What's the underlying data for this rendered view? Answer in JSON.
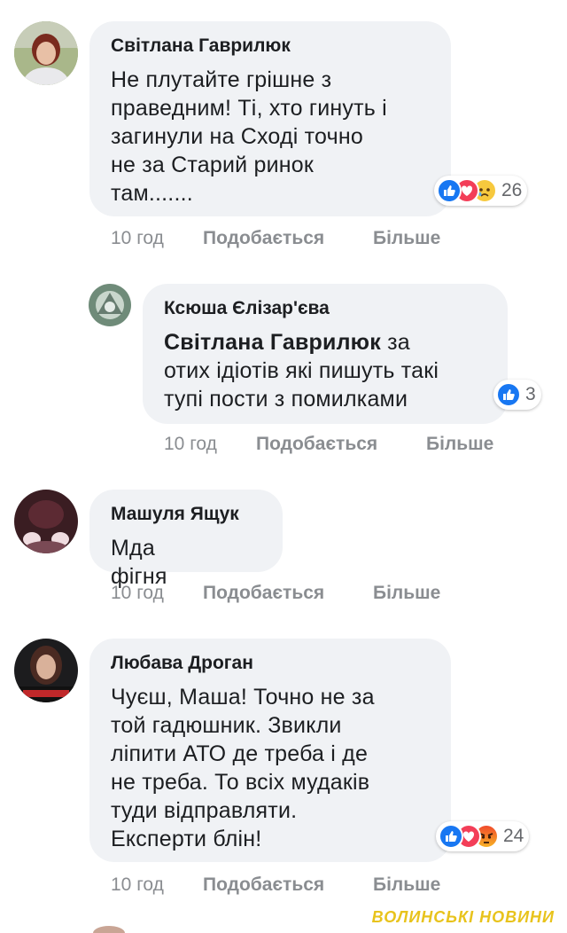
{
  "comments": [
    {
      "author": "Світлана Гаврилюк",
      "lines": [
        "Не плутайте грішне з",
        "праведним! Ті, хто гинуть і",
        "загинули на Сході точно",
        "не за Старий ринок",
        "там......."
      ],
      "time": "10 год",
      "like": "Подобається",
      "more": "Більше",
      "reaction_icons": [
        "like-icon",
        "love-icon",
        "sad-icon"
      ],
      "reaction_count": "26"
    },
    {
      "author": "Ксюша Єлізар'єва",
      "mention": "Світлана Гаврилюк",
      "first_rest": " за",
      "lines": [
        "отих ідіотів які пишуть такі",
        "тупі пости з помилками"
      ],
      "time": "10 год",
      "like": "Подобається",
      "more": "Більше",
      "reaction_icons": [
        "like-icon"
      ],
      "reaction_count": "3"
    },
    {
      "author": "Машуля Ящук",
      "lines": [
        "Мда фігня"
      ],
      "time": "10 год",
      "like": "Подобається",
      "more": "Більше"
    },
    {
      "author": "Любава Дроган",
      "lines": [
        "Чуєш, Маша! Точно не за",
        "той гадюшник. Звикли",
        "ліпити АТО де треба і де",
        "не треба. То всіх мудаків",
        "туди відправляти.",
        "Експерти блін!"
      ],
      "time": "10 год",
      "like": "Подобається",
      "more": "Більше",
      "reaction_icons": [
        "like-icon",
        "love-icon",
        "angry-icon"
      ],
      "reaction_count": "24"
    }
  ],
  "watermark": "ВОЛИНСЬКІ НОВИНИ",
  "colors": {
    "bubble": "#f0f2f5",
    "like": "#1877f2",
    "love": "#f33e58",
    "meta": "#8a8d91",
    "watermark": "#e8c31c"
  }
}
